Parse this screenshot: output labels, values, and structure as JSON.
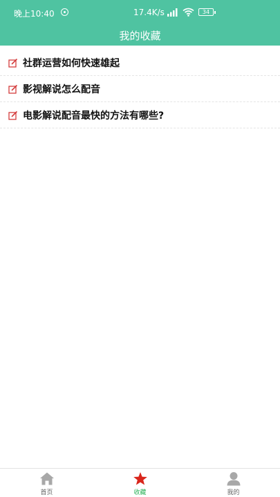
{
  "status": {
    "time": "晚上10:40",
    "speed": "17.4K/s",
    "battery": "34"
  },
  "header": {
    "title": "我的收藏"
  },
  "favorites": [
    {
      "title": "社群运营如何快速雄起",
      "icon": "edit-icon"
    },
    {
      "title": "影视解说怎么配音",
      "icon": "edit-icon"
    },
    {
      "title": "电影解说配音最快的方法有哪些?",
      "icon": "edit-icon"
    }
  ],
  "tabs": [
    {
      "label": "首页",
      "icon": "home-icon"
    },
    {
      "label": "收藏",
      "icon": "star-icon",
      "active": true
    },
    {
      "label": "我的",
      "icon": "user-icon"
    }
  ],
  "colors": {
    "primary": "#4fc3a1",
    "active_tab": "#2db25a",
    "star": "#d9261c",
    "edit_icon": "#d43c3c"
  }
}
